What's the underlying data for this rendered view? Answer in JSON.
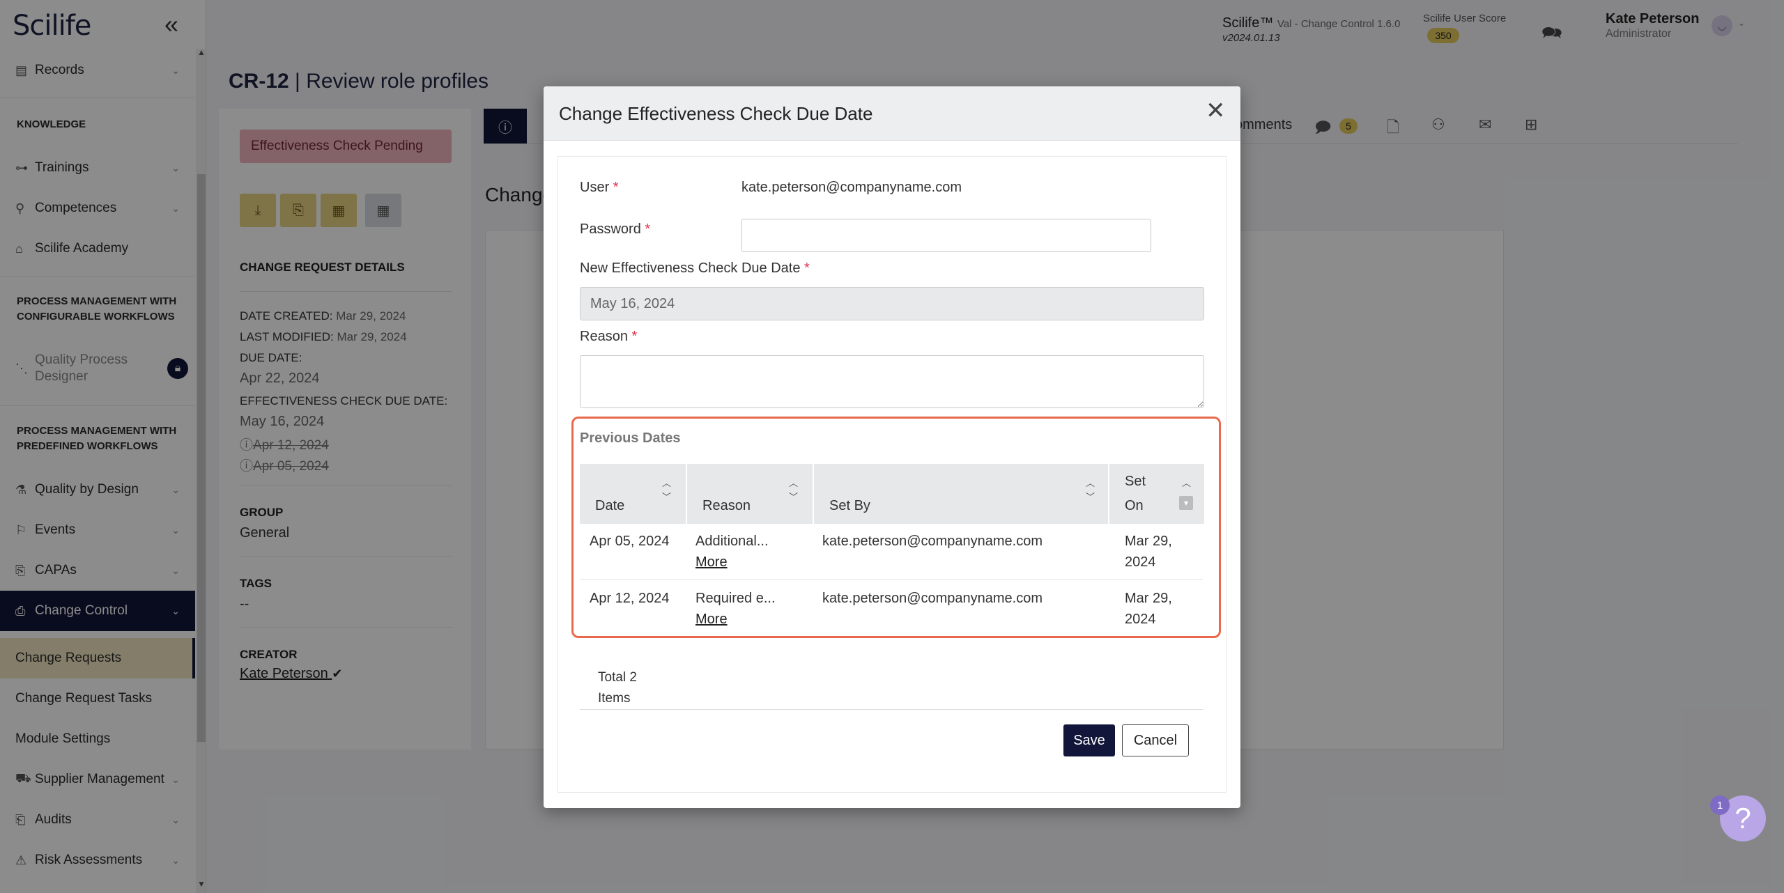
{
  "sidebar": {
    "logo": "Scilife",
    "collapse_icon": "«",
    "records": "Records",
    "knowledge_section": "KNOWLEDGE",
    "trainings": "Trainings",
    "competences": "Competences",
    "academy": "Scilife Academy",
    "pm_configurable_section": "PROCESS MANAGEMENT WITH CONFIGURABLE WORKFLOWS",
    "quality_process_designer": "Quality Process Designer",
    "pm_predefined_section": "PROCESS MANAGEMENT WITH PREDEFINED WORKFLOWS",
    "quality_by_design": "Quality by Design",
    "events": "Events",
    "capas": "CAPAs",
    "change_control": "Change Control",
    "change_requests": "Change Requests",
    "change_request_tasks": "Change Request Tasks",
    "module_settings": "Module Settings",
    "supplier_management": "Supplier Management",
    "audits": "Audits",
    "risk_assessments": "Risk Assessments"
  },
  "header": {
    "app_name": "Scilife™",
    "app_module": "Val - Change Control 1.6.0",
    "app_version": "v2024.01.13",
    "score_label": "Scilife User Score",
    "score_value": "350",
    "user_name": "Kate Peterson",
    "user_role": "Administrator"
  },
  "page": {
    "record_id": "CR-12",
    "separator": "|",
    "record_title": "Review role profiles",
    "status": "Effectiveness Check Pending",
    "details_heading": "CHANGE REQUEST DETAILS",
    "date_created_label": "DATE CREATED:",
    "date_created": "Mar 29, 2024",
    "last_modified_label": "LAST MODIFIED:",
    "last_modified": "Mar 29, 2024",
    "due_date_label": "DUE DATE:",
    "due_date": "Apr 22, 2024",
    "eff_due_label": "EFFECTIVENESS CHECK DUE DATE:",
    "eff_due": "May 16, 2024",
    "eff_old_1": "Apr 12, 2024",
    "eff_old_2": "Apr 05, 2024",
    "group_label": "GROUP",
    "group": "General",
    "tags_label": "TAGS",
    "tags": "--",
    "creator_label": "CREATOR",
    "creator": "Kate Peterson",
    "tab_comments": "omments",
    "tab_badge": "5",
    "content_heading": "Change"
  },
  "modal": {
    "title": "Change Effectiveness Check Due Date",
    "user_label": "User",
    "user_value": "kate.peterson@companyname.com",
    "password_label": "Password",
    "new_date_label": "New Effectiveness Check Due Date",
    "new_date_value": "May 16, 2024",
    "reason_label": "Reason",
    "required_mark": "*",
    "previous_dates_title": "Previous Dates",
    "columns": {
      "date": "Date",
      "reason": "Reason",
      "set_by": "Set By",
      "set_on_1": "Set",
      "set_on_2": "On"
    },
    "rows": [
      {
        "date": "Apr 05, 2024",
        "reason": "Additional...",
        "more": "More",
        "set_by": "kate.peterson@companyname.com",
        "set_on_1": "Mar 29,",
        "set_on_2": "2024"
      },
      {
        "date": "Apr 12, 2024",
        "reason": "Required e...",
        "more": "More",
        "set_by": "kate.peterson@companyname.com",
        "set_on_1": "Mar 29,",
        "set_on_2": "2024"
      }
    ],
    "total_1": "Total 2",
    "total_2": "Items",
    "save": "Save",
    "cancel": "Cancel"
  },
  "help": {
    "badge": "1",
    "icon": "?"
  }
}
